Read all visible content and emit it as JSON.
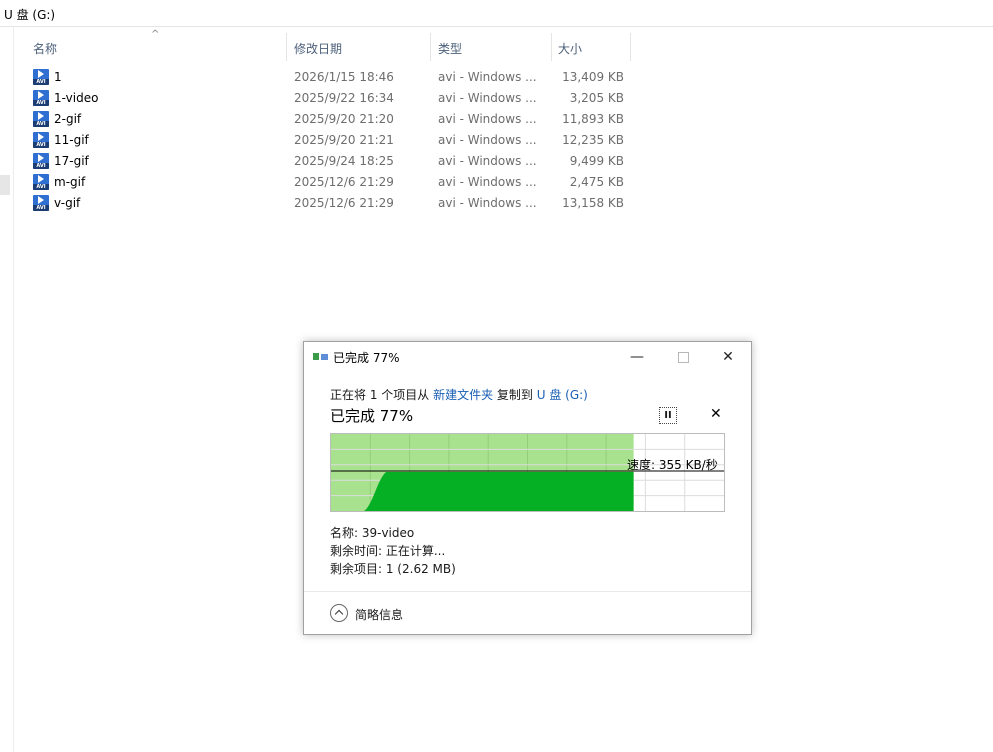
{
  "explorer": {
    "address": "U 盘 (G:)",
    "columns": {
      "name": "名称",
      "date": "修改日期",
      "type": "类型",
      "size": "大小"
    },
    "files": [
      {
        "name": "1",
        "date": "2026/1/15 18:46",
        "type": "avi - Windows ...",
        "size": "13,409 KB"
      },
      {
        "name": "1-video",
        "date": "2025/9/22 16:34",
        "type": "avi - Windows ...",
        "size": "3,205 KB"
      },
      {
        "name": "2-gif",
        "date": "2025/9/20 21:20",
        "type": "avi - Windows ...",
        "size": "11,893 KB"
      },
      {
        "name": "11-gif",
        "date": "2025/9/20 21:21",
        "type": "avi - Windows ...",
        "size": "12,235 KB"
      },
      {
        "name": "17-gif",
        "date": "2025/9/24 18:25",
        "type": "avi - Windows ...",
        "size": "9,499 KB"
      },
      {
        "name": "m-gif",
        "date": "2025/12/6 21:29",
        "type": "avi - Windows ...",
        "size": "2,475 KB"
      },
      {
        "name": "v-gif",
        "date": "2025/12/6 21:29",
        "type": "avi - Windows ...",
        "size": "13,158 KB"
      }
    ],
    "file_icon_label": "AVI"
  },
  "dialog": {
    "title": "已完成 77%",
    "copy_prefix": "正在将 1 个项目从 ",
    "source": "新建文件夹",
    "copy_middle": " 复制到 ",
    "destination": "U 盘 (G:)",
    "progress_text": "已完成 77%",
    "progress_percent": 77,
    "speed_text": "速度: 355 KB/秒",
    "name_line": "名称: 39-video",
    "time_line": "剩余时间: 正在计算...",
    "items_line": "剩余项目: 1 (2.62 MB)",
    "details_label": "简略信息",
    "pause_glyph": "II",
    "cancel_glyph": "✕",
    "minimize_glyph": "—",
    "close_glyph": "✕"
  },
  "colors": {
    "progress_light": "#a8e28f",
    "progress_dark": "#06b025",
    "link": "#1a5fb4"
  },
  "icons": {
    "file": "avi-video-file-icon",
    "pause": "pause-icon",
    "cancel": "close-icon",
    "details": "chevron-up-circle-icon",
    "app": "copy-transfer-icon"
  }
}
